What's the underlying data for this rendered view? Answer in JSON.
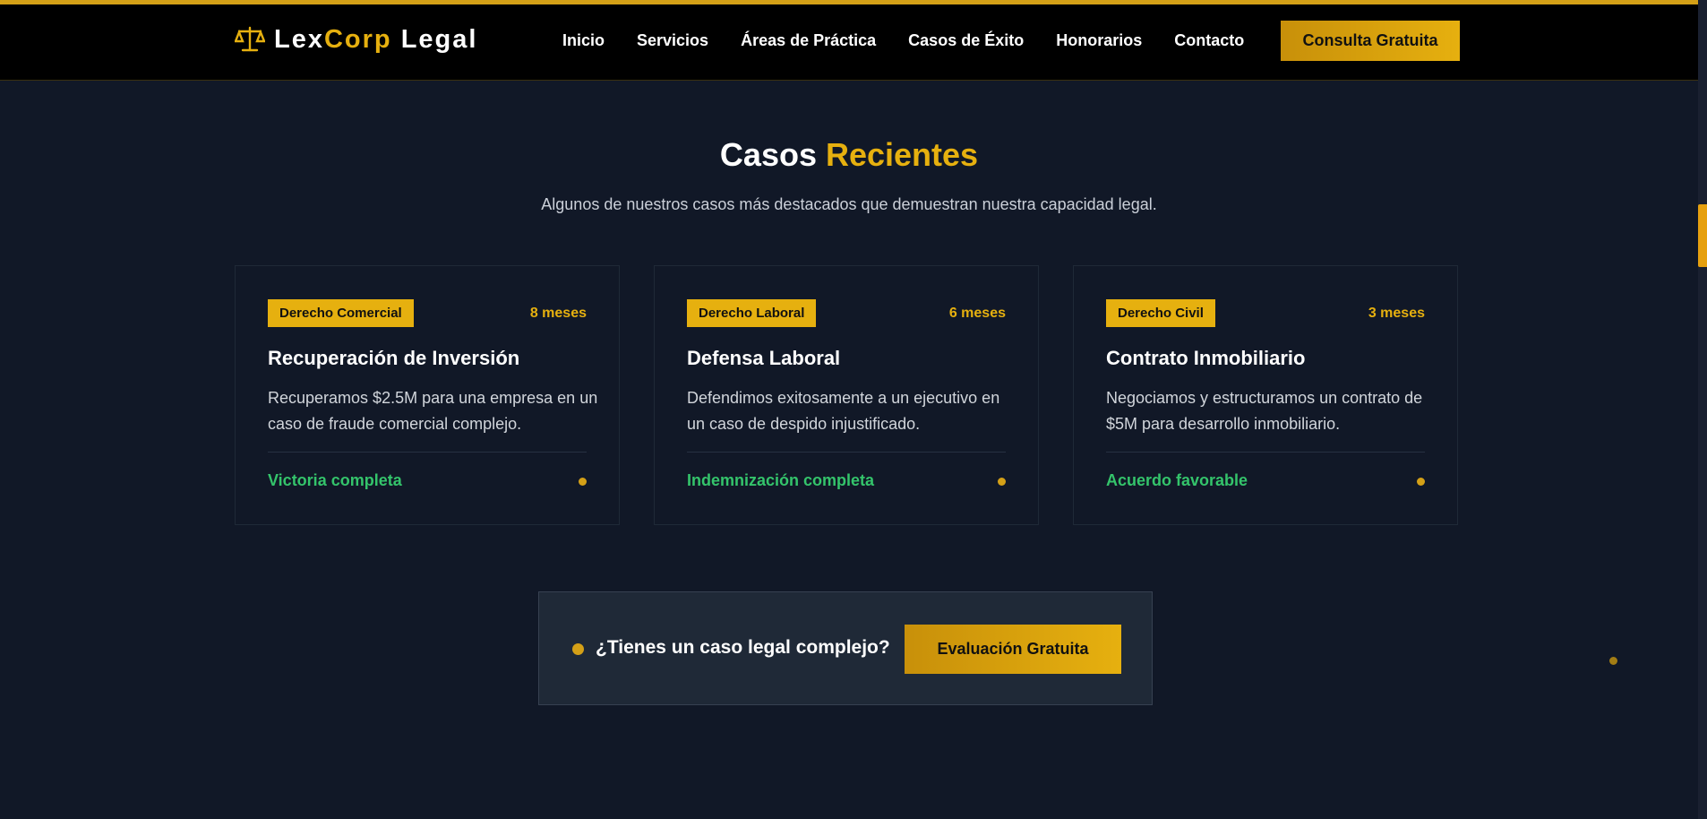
{
  "brand": {
    "name_part1": "Lex",
    "name_part2": "Corp",
    "name_part3": " Legal",
    "icon": "scales-icon"
  },
  "nav": {
    "items": [
      {
        "label": "Inicio"
      },
      {
        "label": "Servicios"
      },
      {
        "label": "Áreas de Práctica"
      },
      {
        "label": "Casos de Éxito"
      },
      {
        "label": "Honorarios"
      },
      {
        "label": "Contacto"
      }
    ],
    "cta_label": "Consulta Gratuita"
  },
  "section": {
    "title_part1": "Casos ",
    "title_part2": "Recientes",
    "subtitle": "Algunos de nuestros casos más destacados que demuestran nuestra capacidad legal."
  },
  "cases": [
    {
      "tag": "Derecho Comercial",
      "duration": "8 meses",
      "title": "Recuperación de Inversión",
      "description": "Recuperamos $2.5M para una empresa en un caso de fraude comercial complejo.",
      "result": "Victoria completa"
    },
    {
      "tag": "Derecho Laboral",
      "duration": "6 meses",
      "title": "Defensa Laboral",
      "description": "Defendimos exitosamente a un ejecutivo en un caso de despido injustificado.",
      "result": "Indemnización completa"
    },
    {
      "tag": "Derecho Civil",
      "duration": "3 meses",
      "title": "Contrato Inmobiliario",
      "description": "Negociamos y estructuramos un contrato de $5M para desarrollo inmobiliario.",
      "result": "Acuerdo favorable"
    }
  ],
  "banner": {
    "question": "¿Tienes un caso legal complejo?",
    "button_label": "Evaluación Gratuita"
  },
  "colors": {
    "accent": "#e6b00f",
    "background": "#111827",
    "success": "#34c46b",
    "header": "#000000"
  }
}
